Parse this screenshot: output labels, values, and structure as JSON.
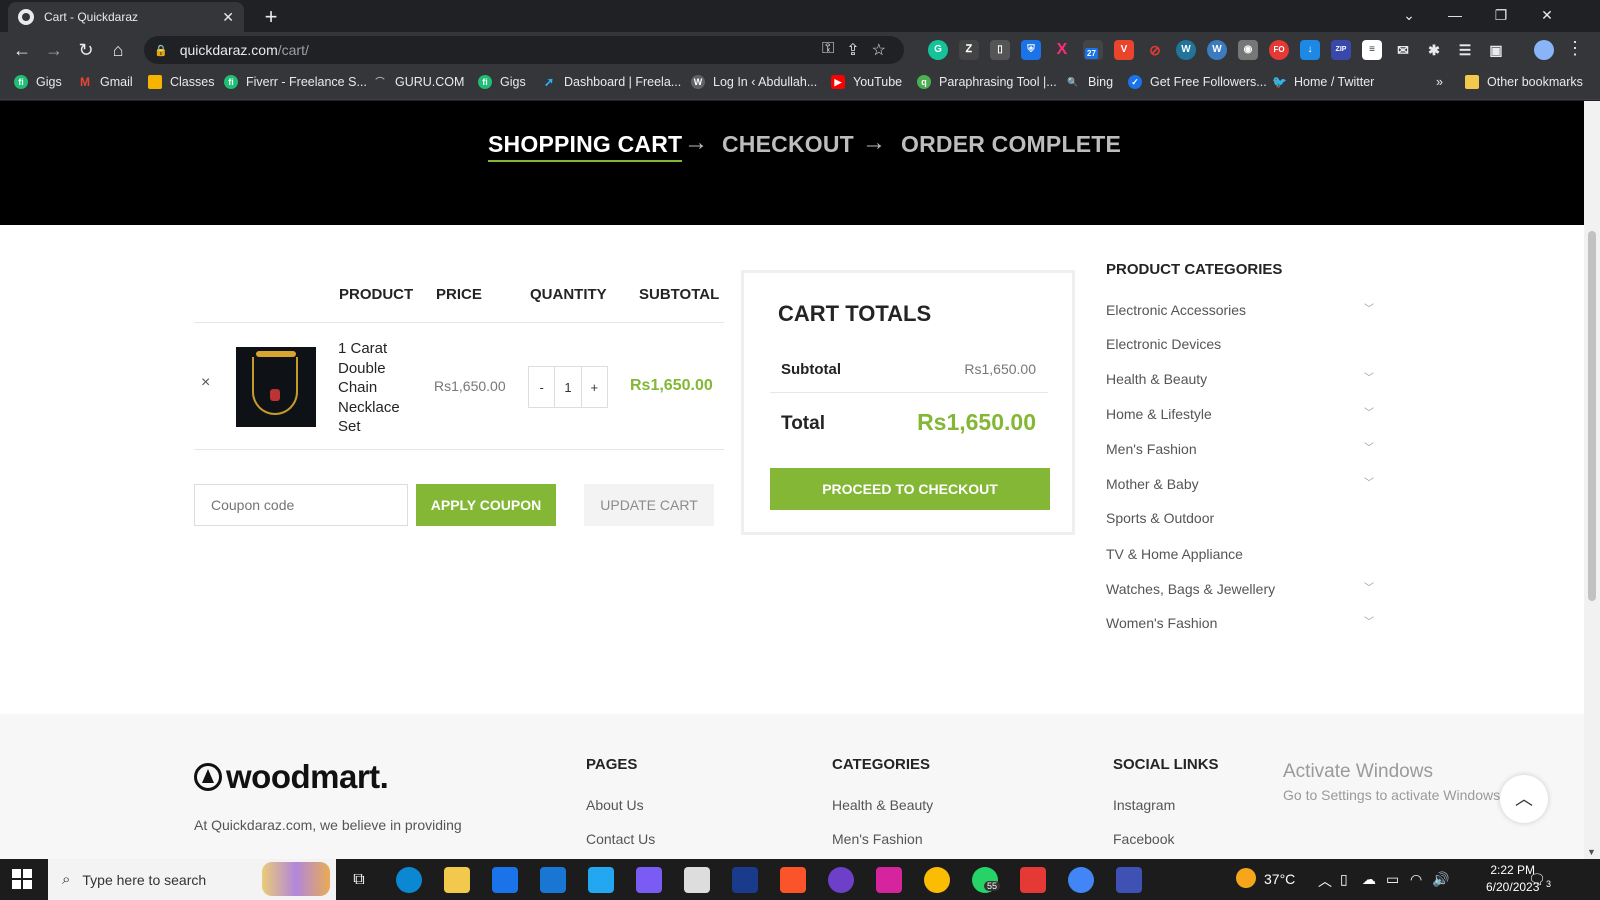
{
  "browser": {
    "tab_title": "Cart - Quickdaraz",
    "url_host": "quickdaraz.com",
    "url_path": "/cart/",
    "bookmarks": [
      {
        "label": "Gigs",
        "icon": "fiverr-icon",
        "color": "#1dbf73"
      },
      {
        "label": "Gmail",
        "icon": "gmail-icon",
        "color": "#ea4335"
      },
      {
        "label": "Classes",
        "icon": "classroom-icon",
        "color": "#f4b400"
      },
      {
        "label": "Fiverr - Freelance S...",
        "icon": "fiverr-icon",
        "color": "#1dbf73"
      },
      {
        "label": "GURU.COM",
        "icon": "guru-icon",
        "color": "#5f6368"
      },
      {
        "label": "Gigs",
        "icon": "fiverr-icon",
        "color": "#1dbf73"
      },
      {
        "label": "Dashboard | Freela...",
        "icon": "freelancer-icon",
        "color": "#29b2fe"
      },
      {
        "label": "Log In ‹ Abdullah...",
        "icon": "wordpress-icon",
        "color": "#5f6368"
      },
      {
        "label": "YouTube",
        "icon": "youtube-icon",
        "color": "#ff0000"
      },
      {
        "label": "Paraphrasing Tool |...",
        "icon": "quillbot-icon",
        "color": "#4caf50"
      },
      {
        "label": "Bing",
        "icon": "bing-search-icon",
        "color": "#4a90e2"
      },
      {
        "label": "Get Free Followers...",
        "icon": "followers-icon",
        "color": "#1a73e8"
      },
      {
        "label": "Home / Twitter",
        "icon": "twitter-icon",
        "color": "#1da1f2"
      }
    ],
    "bookmarks_overflow": "»",
    "other_bookmarks": "Other bookmarks",
    "ext_badge": "27"
  },
  "checkout_steps": {
    "step1": "SHOPPING CART",
    "step2": "CHECKOUT",
    "step3": "ORDER COMPLETE",
    "arrow": "→"
  },
  "cart": {
    "headers": {
      "product": "PRODUCT",
      "price": "PRICE",
      "quantity": "QUANTITY",
      "subtotal": "SUBTOTAL"
    },
    "item": {
      "name": "1 Carat Double Chain Necklace Set",
      "price": "Rs1,650.00",
      "quantity": "1",
      "subtotal": "Rs1,650.00",
      "remove": "×",
      "minus": "-",
      "plus": "+"
    },
    "coupon_placeholder": "Coupon code",
    "apply_coupon": "APPLY COUPON",
    "update_cart": "UPDATE CART"
  },
  "totals": {
    "title": "CART TOTALS",
    "subtotal_label": "Subtotal",
    "subtotal_value": "Rs1,650.00",
    "total_label": "Total",
    "total_value": "Rs1,650.00",
    "checkout_button": "PROCEED TO CHECKOUT"
  },
  "sidebar": {
    "title": "PRODUCT CATEGORIES",
    "categories": [
      {
        "label": "Electronic Accessories",
        "has_children": true
      },
      {
        "label": "Electronic Devices",
        "has_children": false
      },
      {
        "label": "Health & Beauty",
        "has_children": true
      },
      {
        "label": "Home & Lifestyle",
        "has_children": true
      },
      {
        "label": "Men's Fashion",
        "has_children": true
      },
      {
        "label": "Mother & Baby",
        "has_children": true
      },
      {
        "label": "Sports & Outdoor",
        "has_children": false
      },
      {
        "label": "TV & Home Appliance",
        "has_children": false
      },
      {
        "label": "Watches, Bags & Jewellery",
        "has_children": true
      },
      {
        "label": "Women's Fashion",
        "has_children": true
      }
    ]
  },
  "footer": {
    "logo": "woodmart.",
    "about_text": "At Quickdaraz.com, we believe in providing",
    "pages_title": "PAGES",
    "pages": [
      "About Us",
      "Contact Us"
    ],
    "categories_title": "CATEGORIES",
    "categories": [
      "Health & Beauty",
      "Men's Fashion"
    ],
    "social_title": "SOCIAL LINKS",
    "social": [
      "Instagram",
      "Facebook"
    ]
  },
  "windows_watermark": {
    "line1": "Activate Windows",
    "line2": "Go to Settings to activate Windows."
  },
  "taskbar": {
    "search_placeholder": "Type here to search",
    "temperature": "37°C",
    "time": "2:22 PM",
    "date": "6/20/2023",
    "whatsapp_badge": "55",
    "notification_count": "3"
  },
  "colors": {
    "accent": "#83b735",
    "hero_bg": "#000000"
  }
}
